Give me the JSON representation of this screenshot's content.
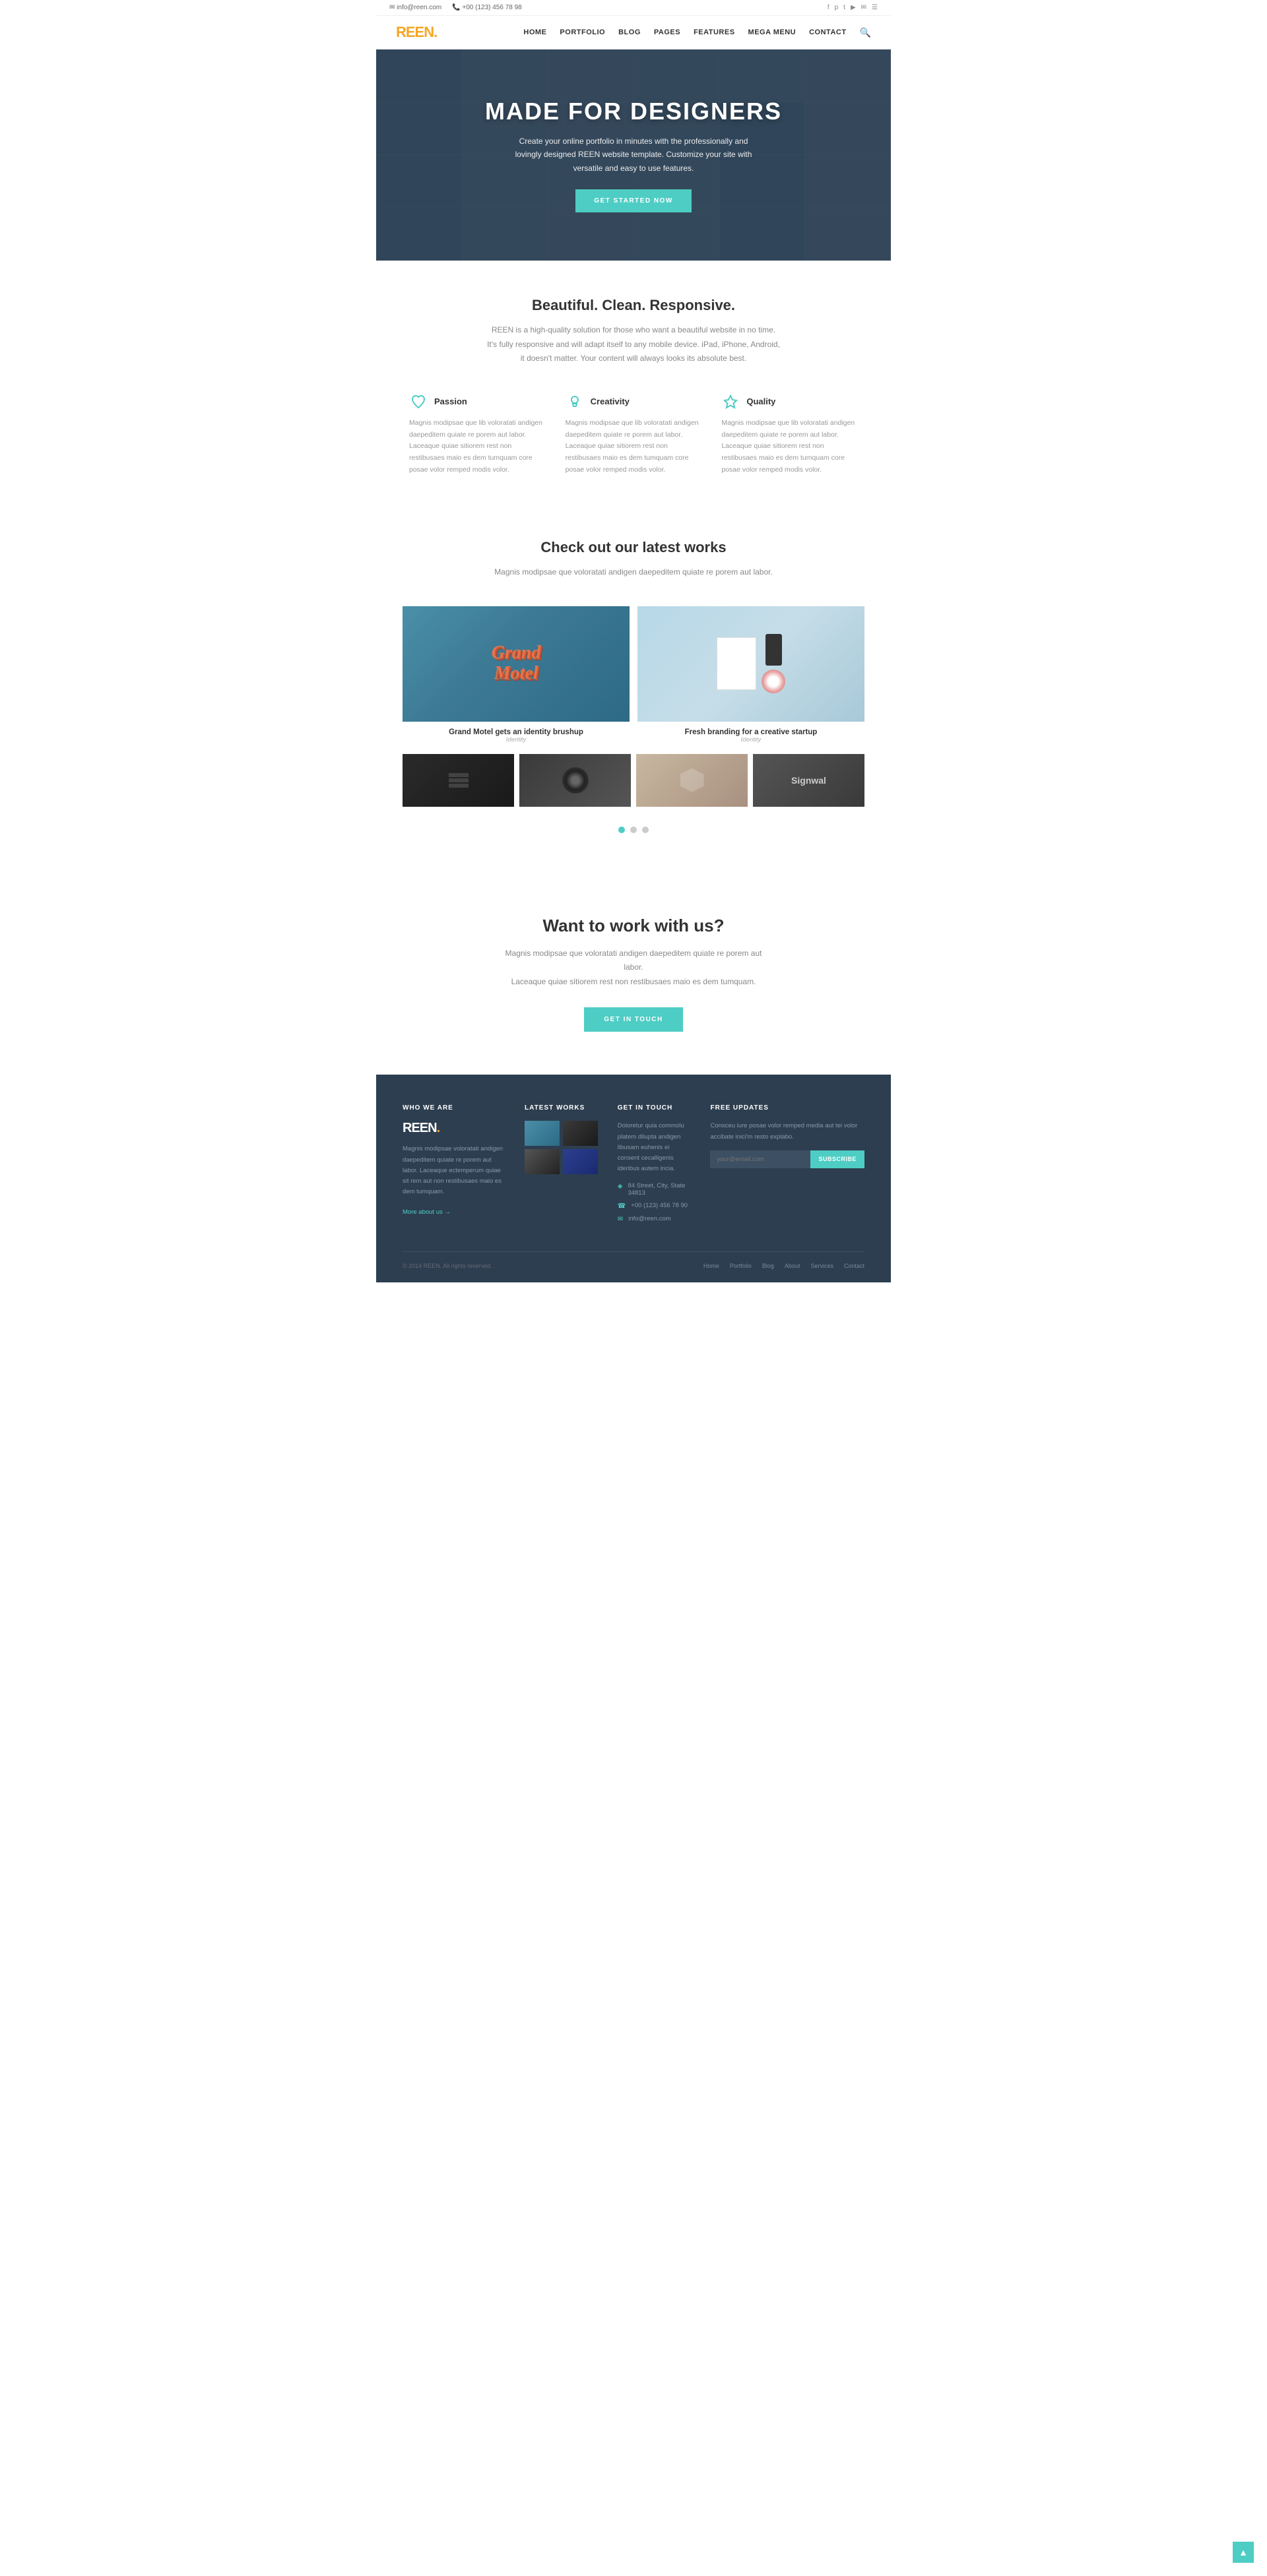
{
  "topbar": {
    "email_icon": "✉",
    "email": "info@reen.com",
    "phone_icon": "📞",
    "phone": "+00 (123) 456 78 98",
    "social": [
      "f",
      "p",
      "t",
      "p",
      "✉",
      "☰"
    ]
  },
  "header": {
    "logo": "REEN",
    "logo_dot": ".",
    "nav_items": [
      "HOME",
      "PORTFOLIO",
      "BLOG",
      "PAGES",
      "FEATURES",
      "MEGA MENU",
      "CONTACT"
    ],
    "search_label": "search"
  },
  "hero": {
    "title": "MADE FOR DESIGNERS",
    "subtitle": "Create your online portfolio in minutes with the professionally and lovingly designed REEN website template. Customize your site with versatile and easy to use features.",
    "cta_label": "GET STARTED NOW"
  },
  "features_section": {
    "title": "Beautiful. Clean. Responsive.",
    "subtitle_line1": "REEN is a high-quality solution for those who want a beautiful website in no time.",
    "subtitle_line2": "It's fully responsive and will adapt itself to any mobile device. iPad, iPhone, Android,",
    "subtitle_line3": "it doesn't matter. Your content will always looks its absolute best.",
    "items": [
      {
        "icon": "heart",
        "title": "Passion",
        "text": "Magnis modipsae que lib voloratati andigen daepeditem quiate re porem aut labor. Laceaque quiae sitiorem rest non restibusaes maio es dem tumquam core posae volor remped modis volor."
      },
      {
        "icon": "bulb",
        "title": "Creativity",
        "text": "Magnis modipsae que lib voloratati andigen daepeditem quiate re porem aut labor. Laceaque quiae sitiorem rest non restibusaes maio es dem tumquam core posae volor remped modis volor."
      },
      {
        "icon": "star",
        "title": "Quality",
        "text": "Magnis modipsae que lib voloratati andigen daepeditem quiate re porem aut labor. Laceaque quiae sitiorem rest non restibusaes maio es dem tumquam core posae volor remped modis volor."
      }
    ]
  },
  "portfolio_section": {
    "title": "Check out our latest works",
    "subtitle": "Magnis modipsae que voloratati andigen daepeditem quiate re porem aut labor.",
    "main_items": [
      {
        "title": "Grand Motel gets an identity brushup",
        "subtitle": "Identity",
        "type": "grand-motel"
      },
      {
        "title": "Fresh branding for a creative startup",
        "subtitle": "Identity",
        "type": "branding"
      }
    ],
    "small_items": [
      {
        "type": "dark-papers"
      },
      {
        "type": "vinyl"
      },
      {
        "type": "badge"
      },
      {
        "type": "signwal"
      }
    ],
    "dots": [
      true,
      false,
      false
    ]
  },
  "cta_section": {
    "title": "Want to work with us?",
    "text_line1": "Magnis modipsae que voloratati andigen daepeditem quiate re porem aut labor.",
    "text_line2": "Laceaque quiae sitiorem rest non restibusaes maio es dem tumquam.",
    "btn_label": "GET IN TOUCH"
  },
  "footer": {
    "who_we_are": {
      "col_title": "WHO WE ARE",
      "logo": "REEN",
      "logo_dot": ".",
      "text": "Magnis modipsae voloratati andigen daepeditem quiate re porem aut labor. Laceaque ectemperum quiae sit rem aut non restibusaes maio es dem tumquam.",
      "more_link": "More about us →"
    },
    "latest_works": {
      "col_title": "LATEST WORKS"
    },
    "get_in_touch": {
      "col_title": "GET IN TOUCH",
      "intro": "Doloretur quia commolu platem dilupta andigen libusam euhenis ei consent cecalligenis ideribus autem incia.",
      "address_icon": "◈",
      "address": "84 Street, City, State 34813",
      "phone_icon": "☎",
      "phone": "+00 (123) 456 78 90",
      "email_icon": "✉",
      "email": "info@reen.com"
    },
    "free_updates": {
      "col_title": "FREE UPDATES",
      "text": "Consceu iure posae volor remped media aut tei volor accibate inici'm resto explabo.",
      "placeholder": "your@email.com",
      "btn_label": "SUBSCRIBE"
    },
    "bottom": {
      "copyright": "© 2014 REEN. All rights reserved.",
      "nav_items": [
        "Home",
        "Portfolio",
        "Blog",
        "About",
        "Services",
        "Contact"
      ]
    }
  }
}
